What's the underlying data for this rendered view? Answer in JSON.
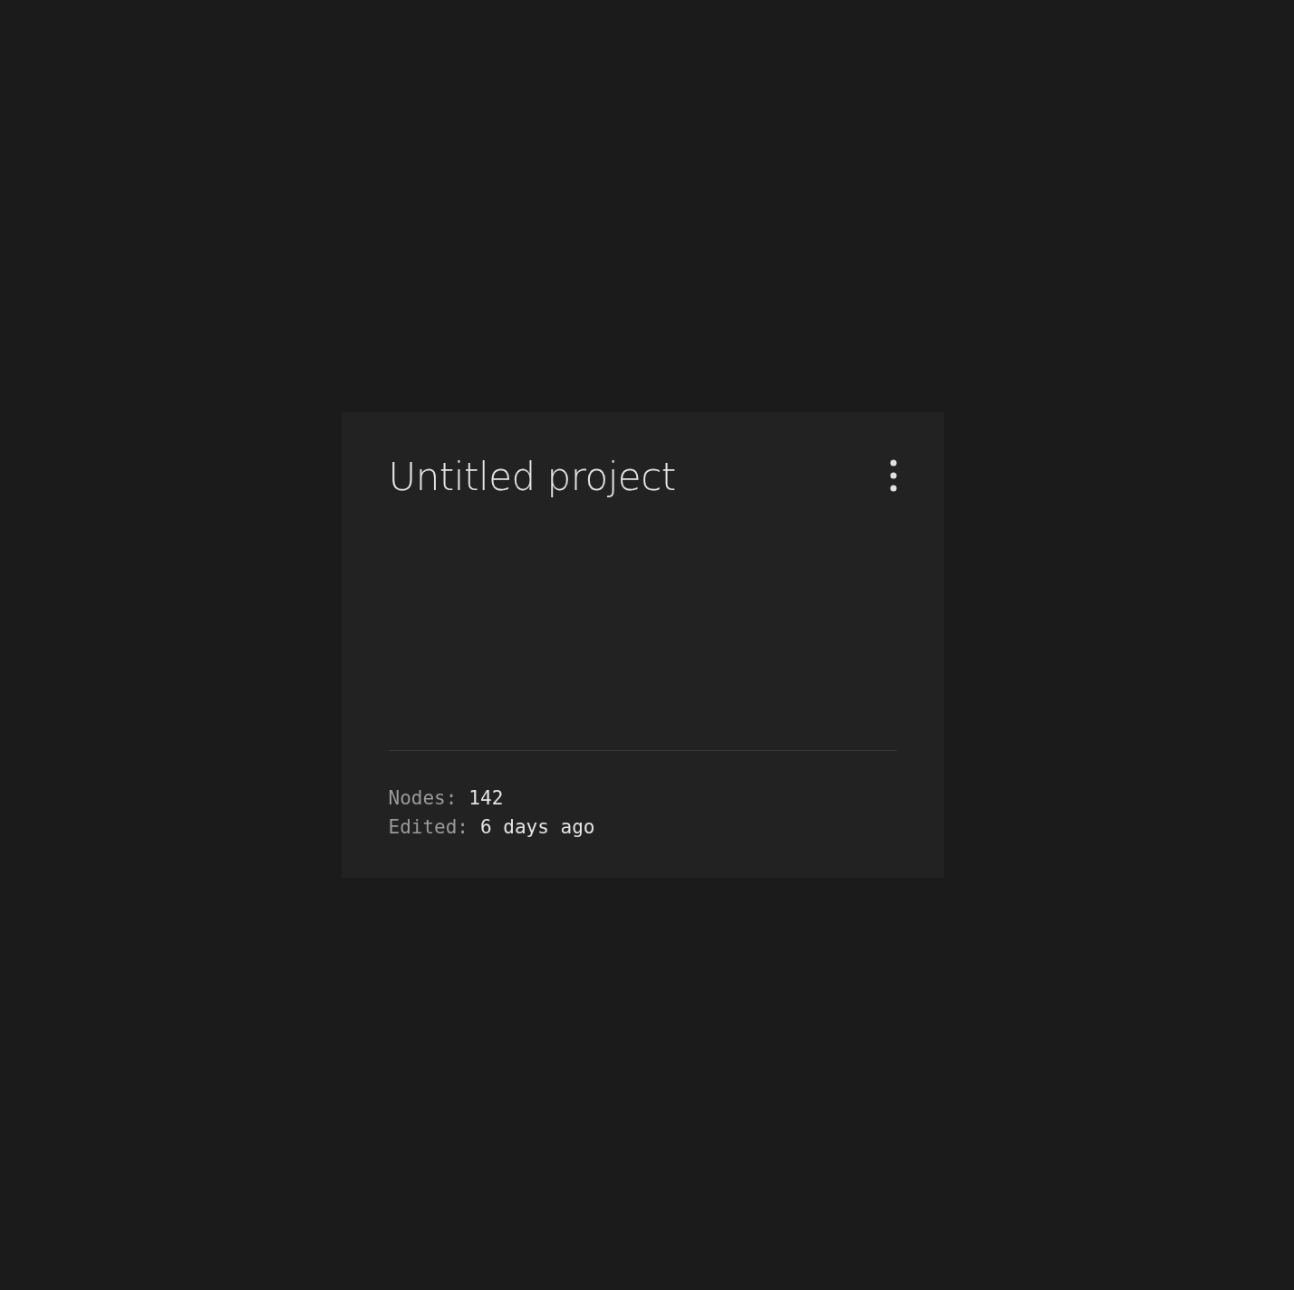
{
  "card": {
    "title": "Untitled project",
    "meta": [
      {
        "label": "Nodes:",
        "value": "142"
      },
      {
        "label": "Edited:",
        "value": "6 days ago"
      }
    ]
  }
}
